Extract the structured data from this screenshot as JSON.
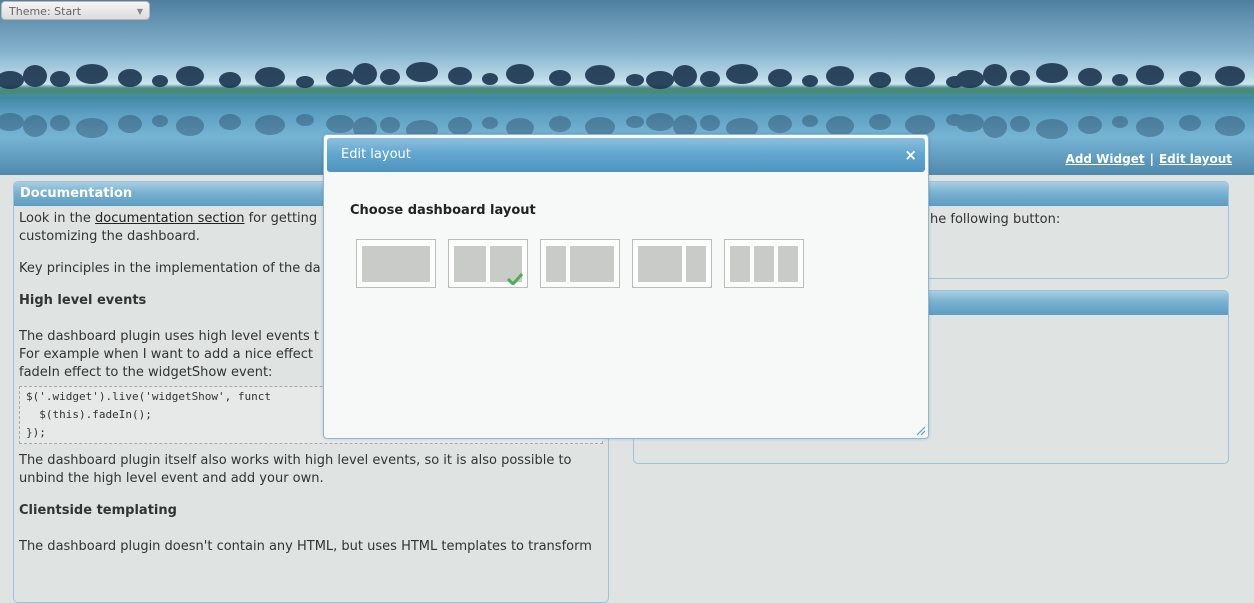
{
  "theme_select": {
    "label": "Theme: Start"
  },
  "header": {
    "add_widget": "Add Widget",
    "separator": "|",
    "edit_layout": "Edit layout"
  },
  "doc_widget": {
    "title": "Documentation",
    "intro_pre": "Look in the ",
    "intro_link": "documentation section",
    "intro_post": " for getting",
    "intro_line2": "customizing the dashboard.",
    "key_principles": "Key principles in the implementation of the da",
    "h_events": "High level events",
    "events_l1": "The dashboard plugin uses high level events t",
    "events_l2": "For example when I want to add a nice effect",
    "events_l3": "fadeIn effect to the widgetShow event:",
    "code_l1": "$('.widget').live('widgetShow', funct",
    "code_l2": "  $(this).fadeIn();",
    "code_l3": "});",
    "after_code_l1": "The dashboard plugin itself also works with high level events, so it is also possible to",
    "after_code_l2": "unbind the high level event and add your own.",
    "h_templating": "Clientside templating",
    "templating_l1": "The dashboard plugin doesn't contain any HTML, but uses HTML templates to transform"
  },
  "right_widget_1": {
    "text": "he following button:"
  },
  "modal": {
    "title": "Edit layout",
    "close": "×",
    "prompt": "Choose dashboard layout",
    "layouts": [
      {
        "name": "single-column",
        "selected": false
      },
      {
        "name": "two-columns-equal",
        "selected": true
      },
      {
        "name": "two-columns-narrow-wide",
        "selected": false
      },
      {
        "name": "two-columns-wide-narrow",
        "selected": false
      },
      {
        "name": "three-columns",
        "selected": false
      }
    ]
  },
  "colors": {
    "header_gradient": "#5c9dc3",
    "check_green": "#4caf50",
    "layout_fill": "#c9cbc8"
  }
}
